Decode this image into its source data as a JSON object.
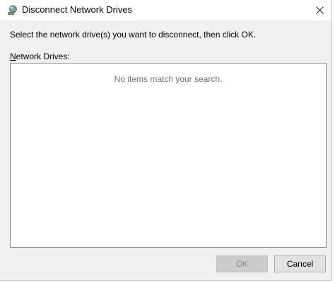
{
  "window": {
    "title": "Disconnect Network Drives",
    "close_glyph": "✕",
    "icon": "network-drive-icon"
  },
  "instruction": "Select the network drive(s) you want to disconnect, then click OK.",
  "list": {
    "label_accel": "N",
    "label_rest": "etwork Drives:",
    "empty_message": "No items match your search."
  },
  "buttons": {
    "ok_label": "OK",
    "ok_enabled": false,
    "cancel_label": "Cancel"
  },
  "colors": {
    "dialog_bg": "#f0f0f0",
    "titlebar_bg": "#ffffff",
    "disabled_text": "#8a8a8a"
  }
}
